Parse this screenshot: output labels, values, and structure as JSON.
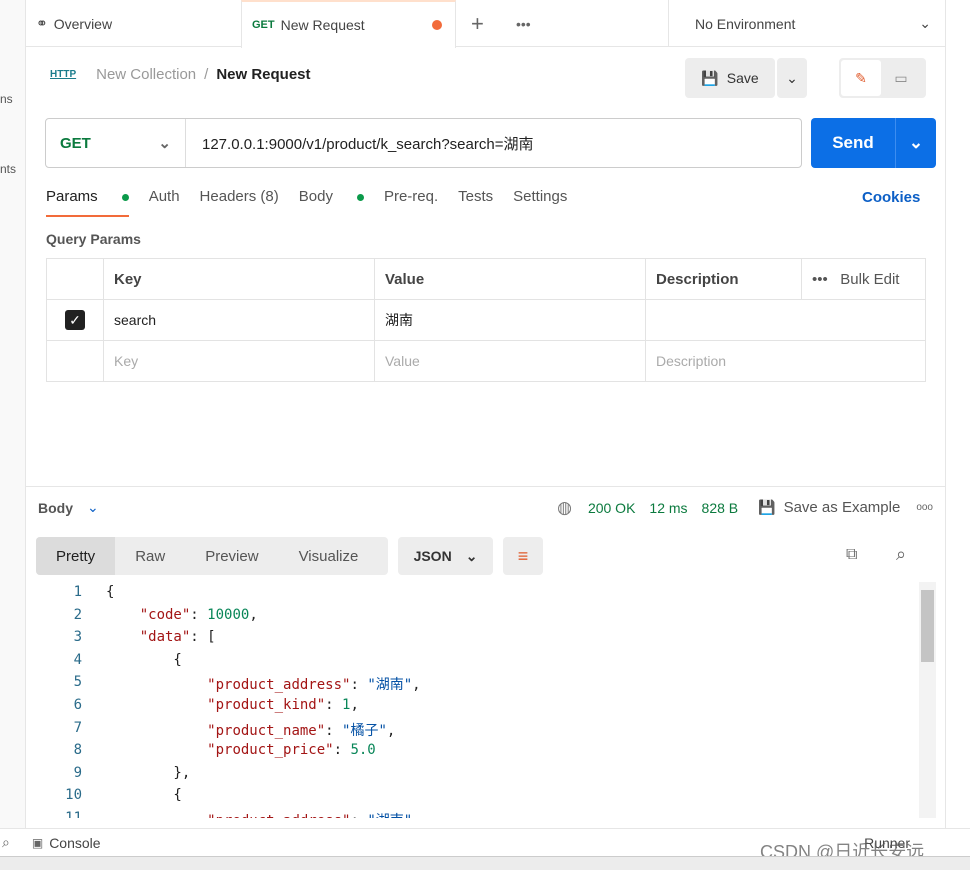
{
  "sidebar": {
    "frag1": "ns",
    "frag2": "nts"
  },
  "tabs": [
    {
      "label": "Overview"
    },
    {
      "method": "GET",
      "label": "New Request"
    }
  ],
  "environment": "No Environment",
  "breadcrumb": {
    "icon": "HTTP",
    "collection": "New Collection",
    "separator": "/",
    "request": "New Request"
  },
  "save_label": "Save",
  "request": {
    "method": "GET",
    "url": "127.0.0.1:9000/v1/product/k_search?search=湖南",
    "send_label": "Send"
  },
  "req_tabs": [
    "Params",
    "Auth",
    "Headers (8)",
    "Body",
    "Pre-req.",
    "Tests",
    "Settings"
  ],
  "cookies": "Cookies",
  "query_params_title": "Query Params",
  "params_table": {
    "headers": [
      "Key",
      "Value",
      "Description"
    ],
    "bulk_edit": "Bulk Edit",
    "rows": [
      {
        "checked": true,
        "key": "search",
        "value": "湖南",
        "description": ""
      }
    ],
    "placeholders": {
      "key": "Key",
      "value": "Value",
      "description": "Description"
    }
  },
  "response": {
    "body_label": "Body",
    "status": "200 OK",
    "time": "12 ms",
    "size": "828 B",
    "save_example": "Save as Example",
    "views": [
      "Pretty",
      "Raw",
      "Preview",
      "Visualize"
    ],
    "format": "JSON"
  },
  "code_lines": [
    [
      [
        "",
        "{"
      ]
    ],
    [
      [
        "",
        "    "
      ],
      [
        "k",
        "\"code\""
      ],
      [
        "",
        ": "
      ],
      [
        "n",
        "10000"
      ],
      [
        "",
        ","
      ]
    ],
    [
      [
        "",
        "    "
      ],
      [
        "k",
        "\"data\""
      ],
      [
        "",
        ": ["
      ]
    ],
    [
      [
        "",
        "        {"
      ]
    ],
    [
      [
        "",
        "            "
      ],
      [
        "k",
        "\"product_address\""
      ],
      [
        "",
        ": "
      ],
      [
        "s",
        "\"湖南\""
      ],
      [
        "",
        ","
      ]
    ],
    [
      [
        "",
        "            "
      ],
      [
        "k",
        "\"product_kind\""
      ],
      [
        "",
        ": "
      ],
      [
        "n",
        "1"
      ],
      [
        "",
        ","
      ]
    ],
    [
      [
        "",
        "            "
      ],
      [
        "k",
        "\"product_name\""
      ],
      [
        "",
        ": "
      ],
      [
        "s",
        "\"橘子\""
      ],
      [
        "",
        ","
      ]
    ],
    [
      [
        "",
        "            "
      ],
      [
        "k",
        "\"product_price\""
      ],
      [
        "",
        ": "
      ],
      [
        "n",
        "5.0"
      ]
    ],
    [
      [
        "",
        "        },"
      ]
    ],
    [
      [
        "",
        "        {"
      ]
    ],
    [
      [
        "",
        "            "
      ],
      [
        "k",
        "\"product_address\""
      ],
      [
        "",
        ": "
      ],
      [
        "s",
        "\"湖南\""
      ],
      [
        "",
        ","
      ]
    ]
  ],
  "footer": {
    "console": "Console",
    "runner": "Runner",
    "watermark": "CSDN @日近长安远"
  }
}
